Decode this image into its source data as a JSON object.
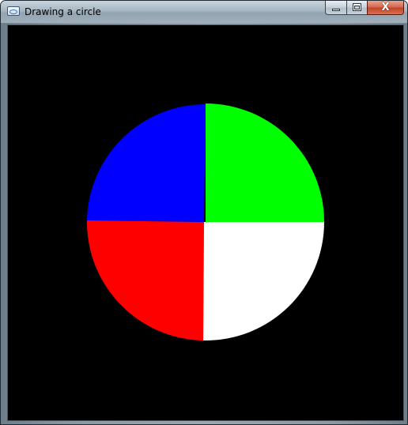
{
  "window": {
    "title": "Drawing a circle",
    "icon": "app-window-icon",
    "buttons": {
      "minimize_icon": "minimize-icon",
      "maximize_icon": "maximize-icon",
      "close_glyph": "X"
    }
  },
  "canvas": {
    "background": "#000000",
    "quadrant_colors": {
      "top_left": "#0000ff",
      "top_right": "#00ff00",
      "bottom_left": "#ff0000",
      "bottom_right": "#ffffff"
    }
  }
}
